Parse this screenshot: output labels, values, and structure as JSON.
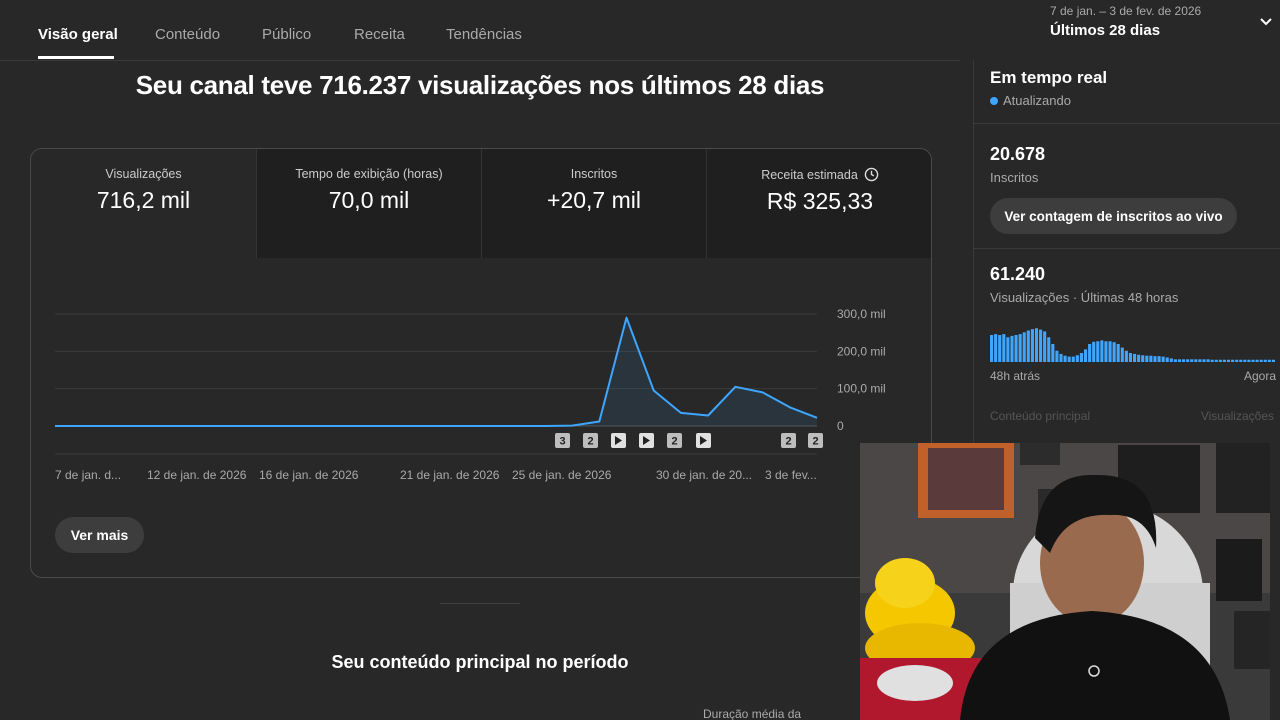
{
  "tabs": [
    {
      "label": "Visão geral",
      "active": true
    },
    {
      "label": "Conteúdo",
      "active": false
    },
    {
      "label": "Público",
      "active": false
    },
    {
      "label": "Receita",
      "active": false
    },
    {
      "label": "Tendências",
      "active": false
    }
  ],
  "date_range": {
    "sub": "7 de jan. – 3 de fev. de 2026",
    "main": "Últimos 28 dias",
    "icon": "chevron-down-icon"
  },
  "headline": "Seu canal teve 716.237 visualizações nos últimos 28 dias",
  "metrics": [
    {
      "label": "Visualizações",
      "value": "716,2 mil",
      "active": true
    },
    {
      "label": "Tempo de exibição (horas)",
      "value": "70,0 mil",
      "active": false
    },
    {
      "label": "Inscritos",
      "value": "+20,7 mil",
      "active": false
    },
    {
      "label": "Receita estimada",
      "value": "R$ 325,33",
      "active": false,
      "icon": "clock-icon"
    }
  ],
  "chart_data": {
    "type": "area",
    "x": [
      "7 jan",
      "8 jan",
      "9 jan",
      "10 jan",
      "11 jan",
      "12 jan",
      "13 jan",
      "14 jan",
      "15 jan",
      "16 jan",
      "17 jan",
      "18 jan",
      "19 jan",
      "20 jan",
      "21 jan",
      "22 jan",
      "23 jan",
      "24 jan",
      "25 jan",
      "26 jan",
      "27 jan",
      "28 jan",
      "29 jan",
      "30 jan",
      "31 jan",
      "1 fev",
      "2 fev",
      "3 fev"
    ],
    "series": [
      {
        "values": [
          0,
          0,
          0,
          0,
          0,
          0,
          0,
          0,
          0,
          0,
          0,
          0,
          0,
          0,
          0,
          0,
          0,
          0,
          0,
          1000,
          12000,
          290000,
          95000,
          35000,
          28000,
          105000,
          90000,
          50000,
          22000
        ]
      }
    ],
    "y_ticks": [
      "300,0 mil",
      "200,0 mil",
      "100,0 mil",
      "0"
    ],
    "ylim": [
      0,
      320000
    ],
    "x_tick_labels": [
      "7 de jan. d...",
      "12 de jan. de 2026",
      "16 de jan. de 2026",
      "21 de jan. de 2026",
      "25 de jan. de 2026",
      "30 de jan. de 20...",
      "3 de fev..."
    ],
    "markers": [
      "3",
      "2",
      "play",
      "play",
      "2",
      "play",
      "2",
      "2"
    ],
    "color": "#3ea6ff",
    "grid": true
  },
  "ver_mais": "Ver mais",
  "section_title": "Seu conteúdo principal no período",
  "duration_label": "Duração média da",
  "realtime": {
    "title": "Em tempo real",
    "status": "Atualizando",
    "subscribers": "20.678",
    "subscribers_label": "Inscritos",
    "live_button": "Ver contagem de inscritos ao vivo",
    "views": "61.240",
    "views_label": "Visualizações · Últimas 48 horas",
    "axis_start": "48h atrás",
    "axis_end": "Agora",
    "faded_left": "Conteúdo principal",
    "faded_right": "Visualizações",
    "bars": [
      60,
      62,
      60,
      62,
      55,
      58,
      60,
      62,
      66,
      70,
      73,
      75,
      72,
      68,
      55,
      40,
      25,
      18,
      14,
      12,
      12,
      15,
      20,
      28,
      40,
      45,
      46,
      48,
      46,
      46,
      44,
      40,
      32,
      25,
      20,
      18,
      16,
      15,
      14,
      14,
      13,
      13,
      12,
      10,
      8,
      6,
      6,
      6,
      6,
      6,
      6,
      6,
      6,
      6,
      5,
      5,
      5,
      5,
      5,
      5,
      5,
      5,
      5,
      5,
      5,
      5,
      5,
      5,
      5,
      5
    ]
  },
  "colors": {
    "accent": "#3ea6ff",
    "background": "#282828"
  }
}
